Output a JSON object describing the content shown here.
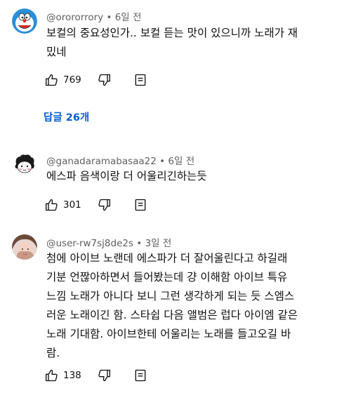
{
  "comments": [
    {
      "handle": "@orororrory",
      "time": "6일 전",
      "text": "보컬의 중요성인가.. 보컬 듣는 맛이 있으니까 노래가 재\n밌네",
      "likes": "769",
      "avatar": "doraemon-avatar"
    },
    {
      "handle": "@ganadaramabasaa22",
      "time": "6일 전",
      "text": "에스파 음색이랑 더 어울리긴하는듯",
      "likes": "301",
      "avatar": "cartoon-avatar"
    },
    {
      "handle": "@user-rw7sj8de2s",
      "time": "3일 전",
      "text": "첨에 아이브 노랜데 에스파가 더 잘어울린다고 하길래\n기분 언짢아하면서 들어봤는데 걍 이해함 아이브 특유\n느낌 노래가 아니다 보니 그런 생각하게 되는 듯 스엠스\n러운 노래이긴 함. 스타쉽 다음 앨범은 럽다 아이엠 같은\n노래 기대함. 아이브한테 어울리는 노래를 들고오길 바\n람.",
      "likes": "138",
      "avatar": "photo-avatar"
    }
  ],
  "replies_label": "답글 26개",
  "separator": " • ",
  "colors": {
    "link": "#065fd4",
    "meta": "#606060",
    "text": "#0f0f0f"
  }
}
